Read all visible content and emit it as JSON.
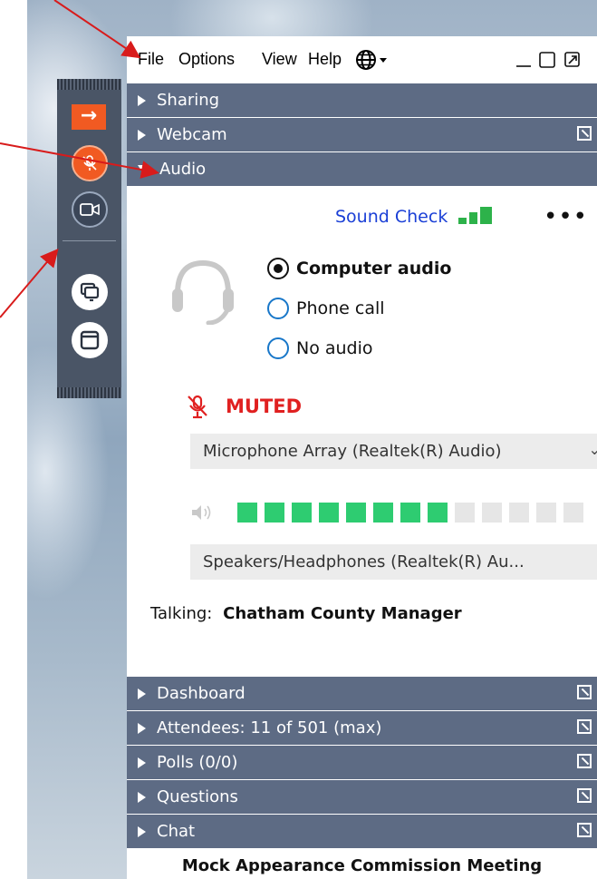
{
  "menu": {
    "file": "File",
    "options": "Options",
    "view": "View",
    "help": "Help"
  },
  "sections": {
    "sharing": "Sharing",
    "webcam": "Webcam",
    "audio": "Audio",
    "dashboard": "Dashboard",
    "attendees": "Attendees: 11 of 501 (max)",
    "polls": "Polls (0/0)",
    "questions": "Questions",
    "chat": "Chat"
  },
  "audio": {
    "sound_check": "Sound Check",
    "more": "•••",
    "options": [
      "Computer audio",
      "Phone call",
      "No audio"
    ],
    "selected_option": "Computer audio",
    "muted_label": "MUTED",
    "microphone": "Microphone Array (Realtek(R) Audio)",
    "speaker_level_segments_lit": 8,
    "speaker_level_segments_total": 13,
    "speakers": "Speakers/Headphones  (Realtek(R)  Au...",
    "talking_label": "Talking:",
    "talking_name": "Chatham County Manager"
  },
  "footer": {
    "title": "Mock Appearance Commission Meeting"
  },
  "colors": {
    "accent_orange": "#f15a22",
    "bar_blue": "#5d6b84",
    "muted_red": "#e02020",
    "link_blue": "#1a3fd6",
    "signal_green": "#2db24a"
  }
}
